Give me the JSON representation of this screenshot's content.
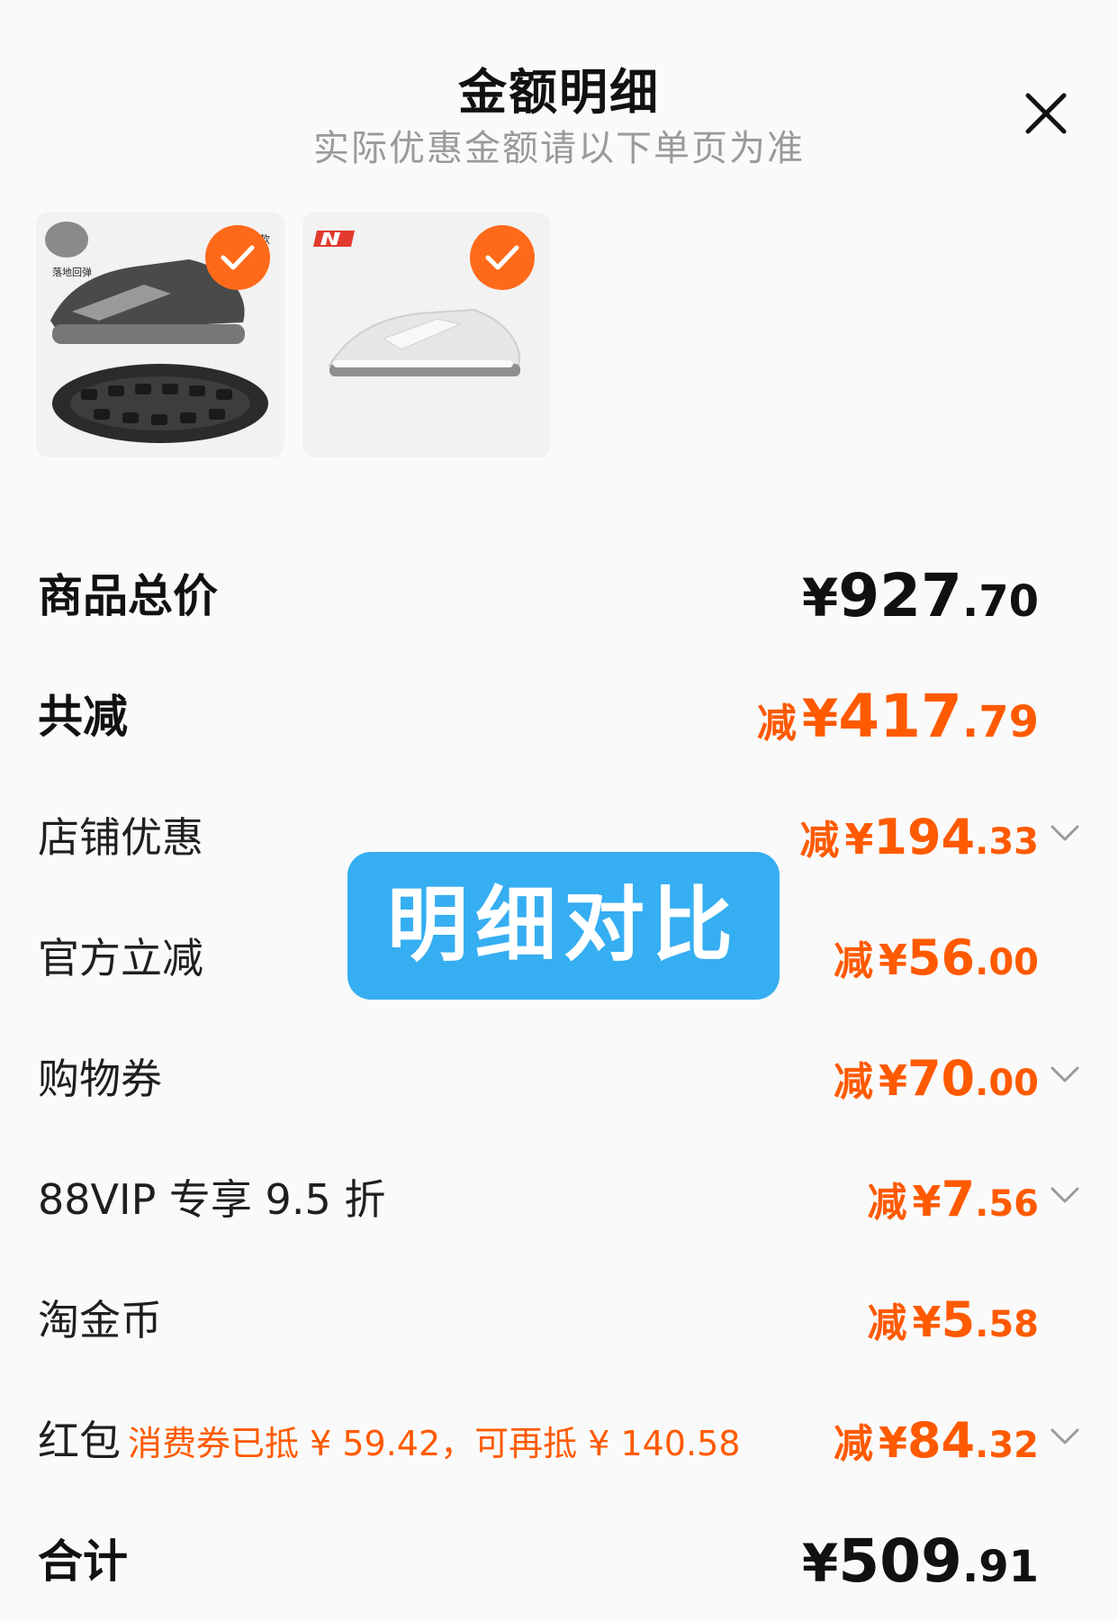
{
  "header": {
    "title": "金额明细",
    "subtitle": "实际优惠金额请以下单页为准"
  },
  "icons": {
    "close": "close-icon",
    "check": "check-icon",
    "chevron": "chevron-down-icon"
  },
  "products": [
    {
      "name": "product-1",
      "selected": true,
      "thumb_text": [
        "落地回弹",
        "款"
      ]
    },
    {
      "name": "product-2",
      "selected": true
    }
  ],
  "rows": {
    "subtotal": {
      "label": "商品总价",
      "currency": "¥",
      "int": "927",
      "dec": ".70"
    },
    "total_discount": {
      "label": "共减",
      "prefix": "减",
      "currency": "¥",
      "int": "417",
      "dec": ".79"
    },
    "shop_discount": {
      "label": "店铺优惠",
      "prefix": "减",
      "currency": "¥",
      "int": "194",
      "dec": ".33"
    },
    "official_discount": {
      "label": "官方立减",
      "prefix": "减",
      "currency": "¥",
      "int": "56",
      "dec": ".00"
    },
    "shopping_voucher": {
      "label": "购物券",
      "prefix": "减",
      "currency": "¥",
      "int": "70",
      "dec": ".00"
    },
    "vip": {
      "label": "88VIP 专享 9.5 折",
      "prefix": "减",
      "currency": "¥",
      "int": "7",
      "dec": ".56"
    },
    "coins": {
      "label": "淘金币",
      "prefix": "减",
      "currency": "¥",
      "int": "5",
      "dec": ".58"
    },
    "redpacket": {
      "label": "红包",
      "note": "消费券已抵 ¥ 59.42，可再抵 ¥ 140.58",
      "prefix": "减",
      "currency": "¥",
      "int": "84",
      "dec": ".32"
    },
    "total": {
      "label": "合计",
      "currency": "¥",
      "int": "509",
      "dec": ".91"
    }
  },
  "overlay": {
    "text": "明细对比"
  },
  "colors": {
    "accent": "#ff5a00",
    "badge": "#36aef2",
    "check": "#ff6a1a"
  }
}
